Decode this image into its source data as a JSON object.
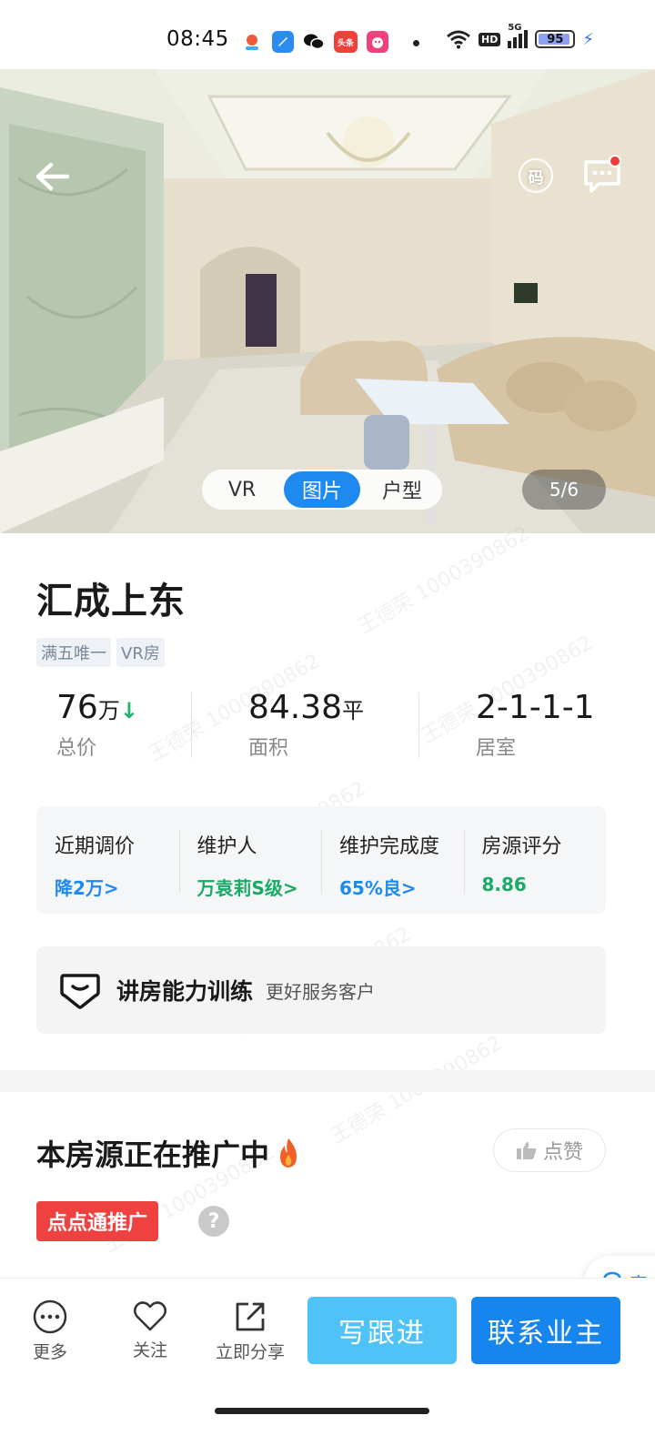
{
  "status_bar": {
    "time": "08:45",
    "network_badge": "HD",
    "signal_label": "5G",
    "battery_percent": 95,
    "battery_label": "95",
    "app_icons": [
      "maps-icon",
      "browser-icon",
      "wechat-icon",
      "toutiao-icon",
      "app-icon"
    ],
    "toutiao_label": "头条"
  },
  "hero": {
    "code_button_label": "码",
    "media_tabs": [
      "VR",
      "图片",
      "户型"
    ],
    "active_tab_index": 1,
    "photo_counter": "5/6"
  },
  "listing": {
    "title": "汇成上东",
    "tags": [
      "满五唯一",
      "VR房"
    ],
    "stats": [
      {
        "value": "76",
        "unit": "万",
        "label": "总价",
        "trend": "down"
      },
      {
        "value": "84.38",
        "unit": "平",
        "label": "面积"
      },
      {
        "value": "2-1-1-1",
        "unit": "",
        "label": "居室"
      }
    ]
  },
  "metrics": [
    {
      "label": "近期调价",
      "value": "降2万>",
      "color": "#1e8af0"
    },
    {
      "label": "维护人",
      "value": "万袁莉S级>",
      "color": "#1aaa66"
    },
    {
      "label": "维护完成度",
      "value": "65%良>",
      "color": "#1e8af0"
    },
    {
      "label": "房源评分",
      "value": "8.86",
      "color": "#1aaa66"
    }
  ],
  "training": {
    "title": "讲房能力训练",
    "subtitle": "更好服务客户"
  },
  "promotion": {
    "title": "本房源正在推广中",
    "like_label": "点赞",
    "badge_label": "点点通推广",
    "help_label": "?"
  },
  "floating": {
    "cs_label": "客"
  },
  "bottom_bar": {
    "more_label": "更多",
    "follow_label": "关注",
    "share_label": "立即分享",
    "write_followup_label": "写跟进",
    "contact_owner_label": "联系业主"
  },
  "watermark_text": "王德荣 1000390862",
  "colors": {
    "accent_blue": "#1686ee",
    "light_blue": "#4fc3f7",
    "green": "#1aaa66",
    "promo_red": "#f04141"
  }
}
